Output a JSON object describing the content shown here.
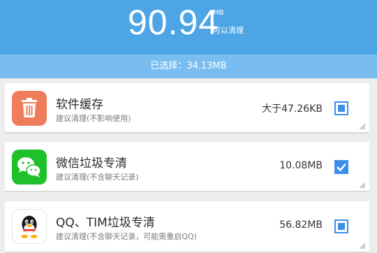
{
  "header": {
    "value": "90.94",
    "unit": "MB",
    "unit_label": "可以清理",
    "color": "#4ea5e6"
  },
  "selected": {
    "text": "已选择：34.13MB"
  },
  "items": [
    {
      "title": "软件缓存",
      "subtitle": "建议清理(不影响使用)",
      "size": "大于47.26KB",
      "icon": "trash-icon",
      "check_state": "partial"
    },
    {
      "title": "微信垃圾专清",
      "subtitle": "建议清理(不含聊天记录)",
      "size": "10.08MB",
      "icon": "wechat-icon",
      "check_state": "checked"
    },
    {
      "title": "QQ、TIM垃圾专清",
      "subtitle": "建议清理(不含聊天记录，可能需重启QQ)",
      "size": "56.82MB",
      "icon": "qq-icon",
      "check_state": "partial"
    }
  ]
}
